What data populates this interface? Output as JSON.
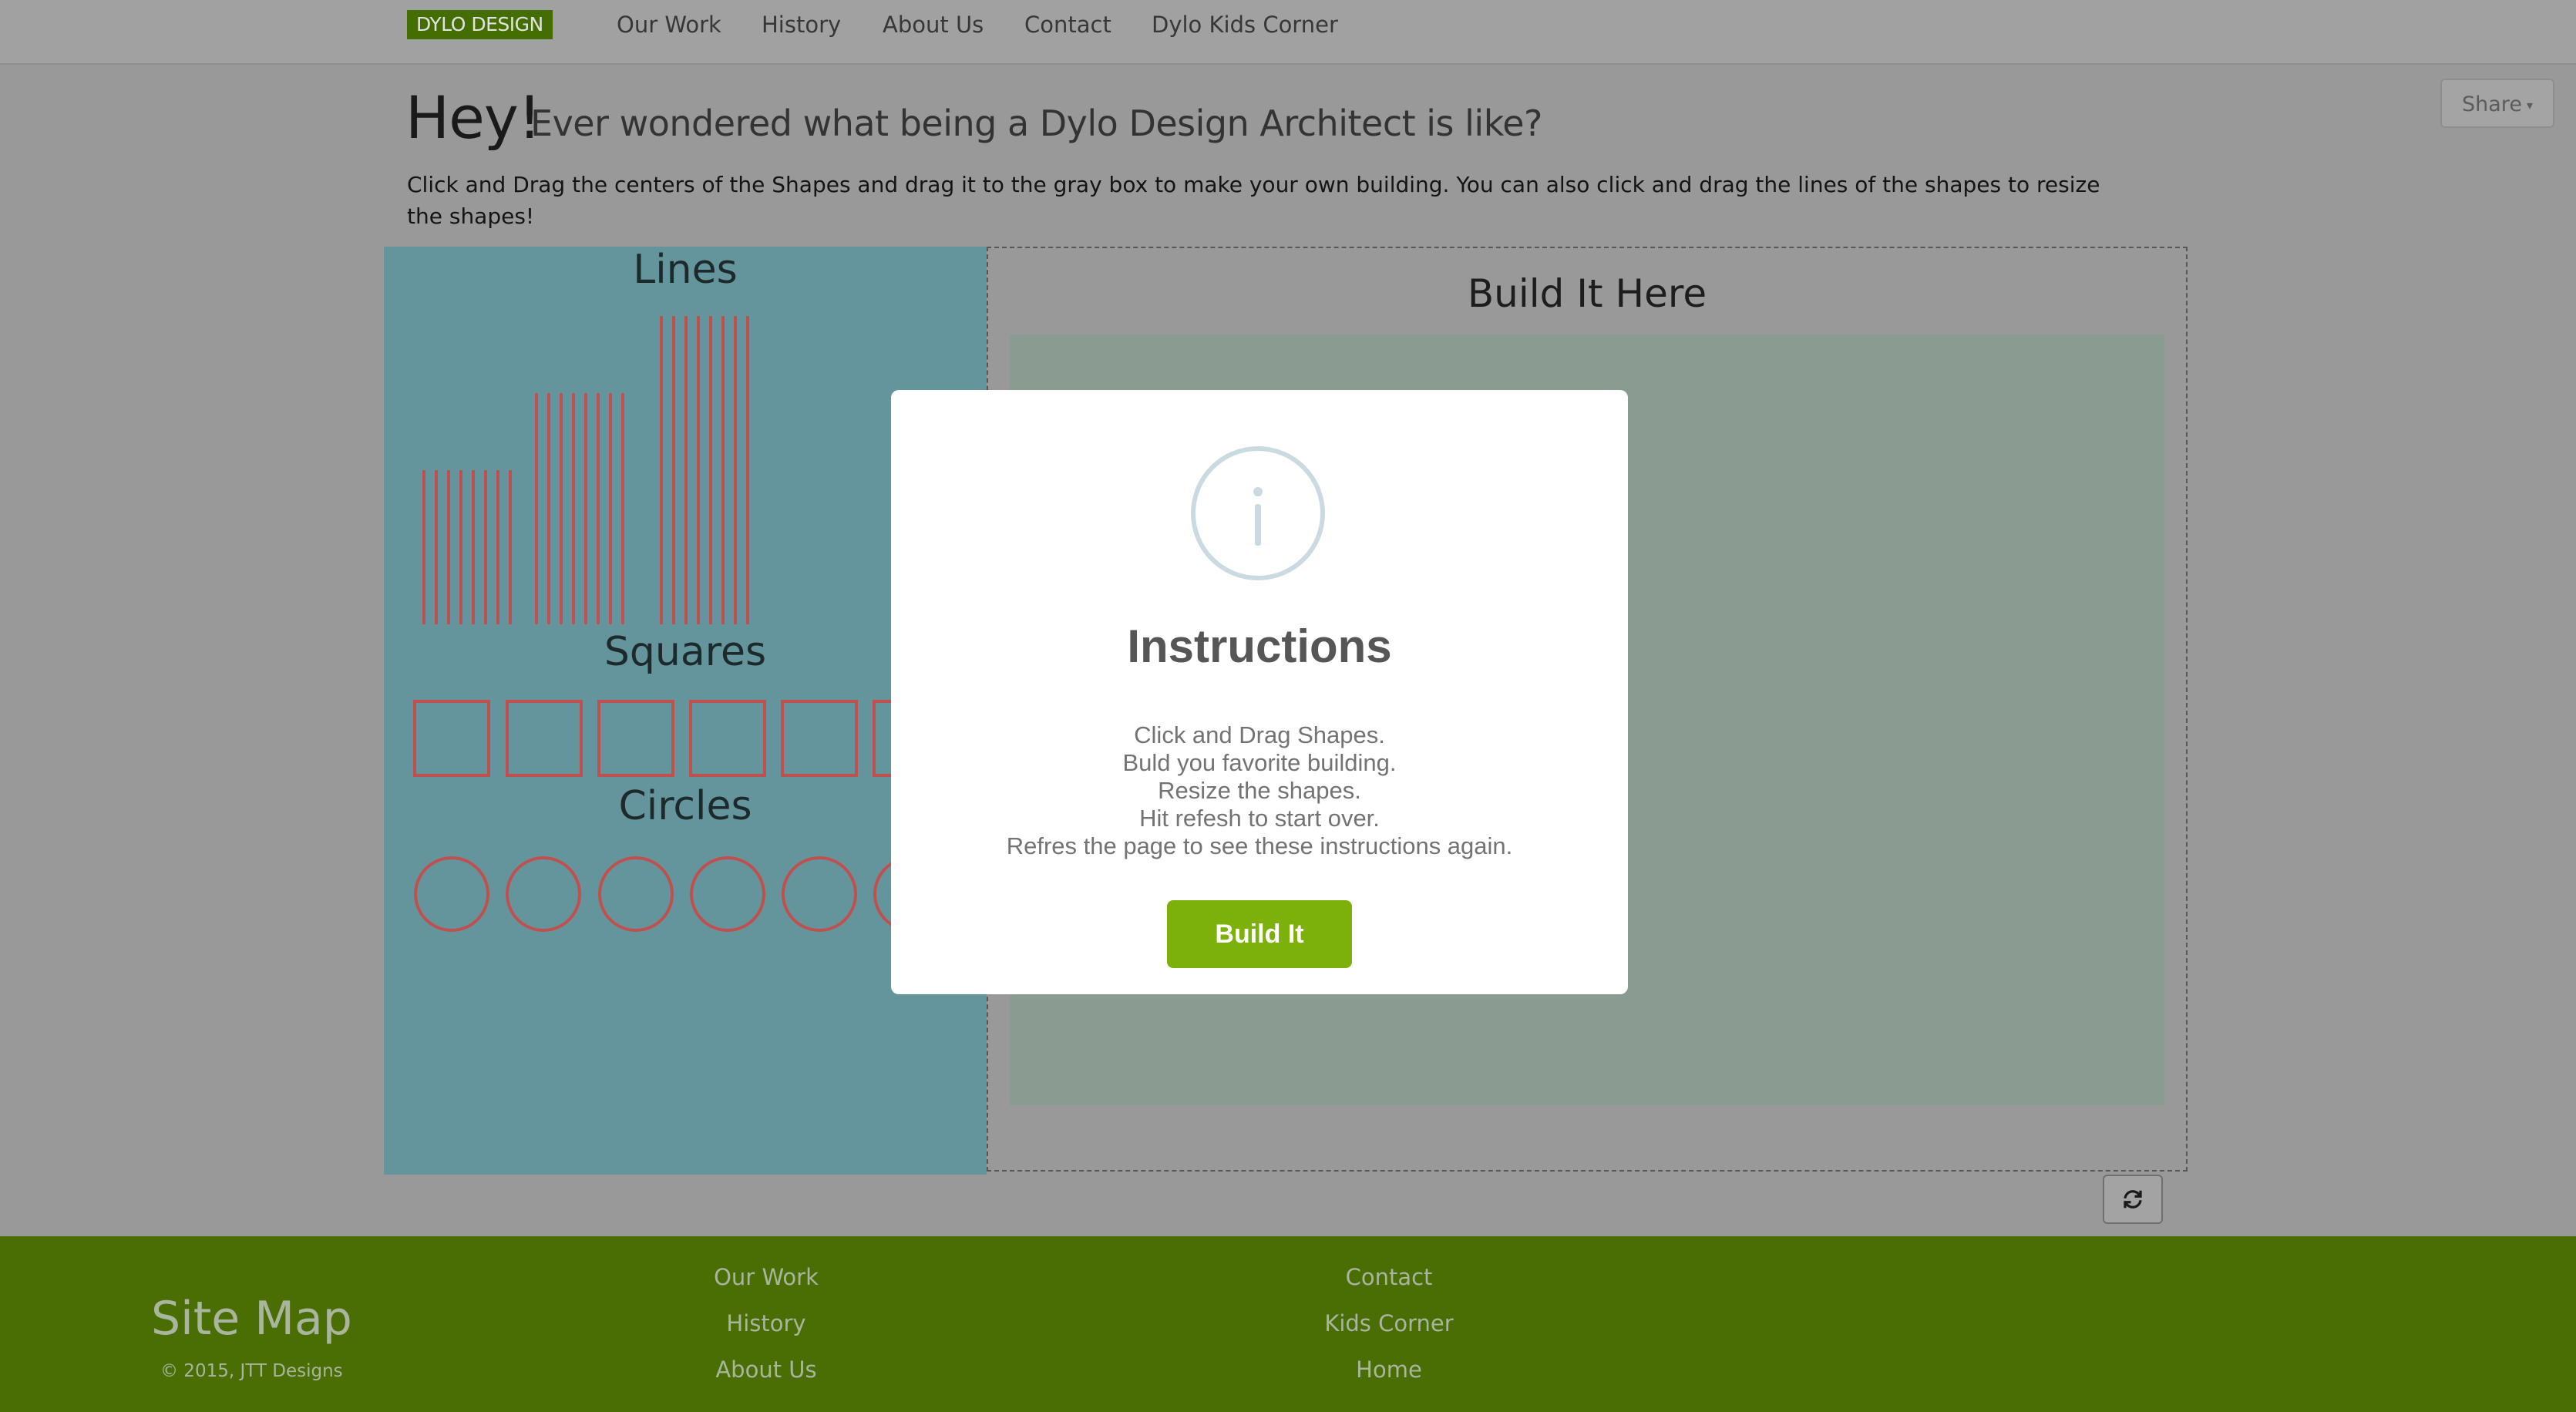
{
  "navbar": {
    "brand": "DYLO DESIGN",
    "items": [
      "Our Work",
      "History",
      "About Us",
      "Contact",
      "Dylo Kids Corner"
    ],
    "share_label": "Share"
  },
  "hero": {
    "hey": "Hey!",
    "subtitle": "Ever wondered what being a Dylo Design Architect is like?",
    "intro": "Click and Drag the centers of the Shapes and drag it to the gray box to make your own building. You can also click and drag the lines of the shapes to resize the shapes!"
  },
  "palette": {
    "lines_title": "Lines",
    "squares_title": "Squares",
    "circles_title": "Circles"
  },
  "build": {
    "title": "Build It Here"
  },
  "modal": {
    "title": "Instructions",
    "lines": [
      "Click and Drag Shapes.",
      "Buld you favorite building.",
      "Resize the shapes.",
      "Hit refesh to start over.",
      "Refres the page to see these instructions again."
    ],
    "button_label": "Build It"
  },
  "footer": {
    "heading": "Site Map",
    "copyright": "© 2015, JTT Designs",
    "col1": [
      "Our Work",
      "History",
      "About Us"
    ],
    "col2": [
      "Contact",
      "Kids Corner",
      "Home"
    ]
  },
  "icons": {
    "info": "info-circle-icon",
    "refresh": "refresh-icon",
    "caret": "caret-down-icon"
  },
  "colors": {
    "brand_green": "#7cb10c",
    "footer_green": "#4a6e03",
    "palette_bg": "#64959d",
    "shape_stroke": "#c0504d"
  }
}
